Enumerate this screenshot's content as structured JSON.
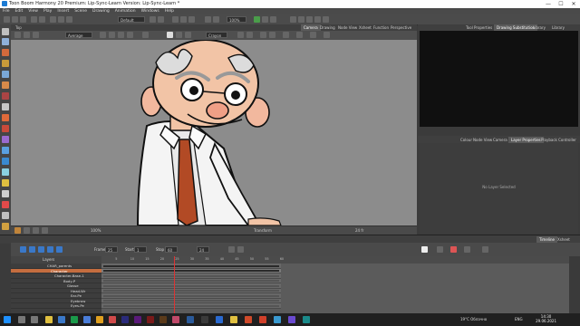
{
  "window": {
    "title": "Toon Boom Harmony 20 Premium: Lip-Sync-Learn Version: Lip-Sync-Learn *",
    "controls": [
      "—",
      "☐",
      "✕"
    ]
  },
  "menu": [
    "File",
    "Edit",
    "View",
    "Play",
    "Insert",
    "Scene",
    "Drawing",
    "Animation",
    "Windows",
    "Help"
  ],
  "toolbar": {
    "workspace_value": "Default",
    "zoom_value": "100%"
  },
  "camera_panel": {
    "tabs": [
      "Camera",
      "Drawing",
      "Node View",
      "Xsheet",
      "Function",
      "Perspective"
    ],
    "active_tab": "Camera",
    "top_label": "Top",
    "view_mode": "Average",
    "tool_value": "Crayon",
    "status": {
      "zoom": "100%",
      "mode": "Transform",
      "fps": "24 fr",
      "coords": "N:0.0 E:0.0"
    }
  },
  "right_panel": {
    "tabs": [
      "Tool Properties",
      "Drawing Substitution",
      "Library",
      "Library"
    ],
    "active_tab": "Drawing Substitution",
    "lower_tabs": [
      "Colour",
      "Node View",
      "Camera",
      "Layer Properties",
      "Playback Controller"
    ],
    "lower_active": "Layer Properties",
    "no_layer_text": "No Layer Selected"
  },
  "timeline": {
    "tabs": [
      "Timeline",
      "Xsheet"
    ],
    "active_tab": "Timeline",
    "frame_label": "Frame",
    "frame_value": "25",
    "start_label": "Start",
    "start_value": "1",
    "stop_label": "Stop",
    "stop_value": "60",
    "fps_value": "24",
    "layer_header": "Layers",
    "layers": [
      {
        "name": "CHAR_parents",
        "selected": false
      },
      {
        "name": "Character",
        "selected": true
      },
      {
        "name": "Character-Base-1",
        "selected": false
      },
      {
        "name": "Body-P",
        "selected": false
      },
      {
        "name": "Glasse",
        "selected": false
      },
      {
        "name": "Head-Wr",
        "selected": false
      },
      {
        "name": "Ear-Pe",
        "selected": false
      },
      {
        "name": "Eyebrow",
        "selected": false
      },
      {
        "name": "Eyes-Pe",
        "selected": false
      }
    ],
    "ruler_ticks": [
      "5",
      "10",
      "15",
      "20",
      "25",
      "30",
      "35",
      "40",
      "45",
      "50",
      "55",
      "60"
    ],
    "current_frame": 25
  },
  "taskbar": {
    "weather": "19°C  Облачно",
    "lang": "ENG",
    "time": "14:30",
    "date": "29.06.2021"
  },
  "colors": {
    "accent_orange": "#c46d3f",
    "playhead_red": "#d33333",
    "viewport_gray": "#8c8c8c"
  }
}
